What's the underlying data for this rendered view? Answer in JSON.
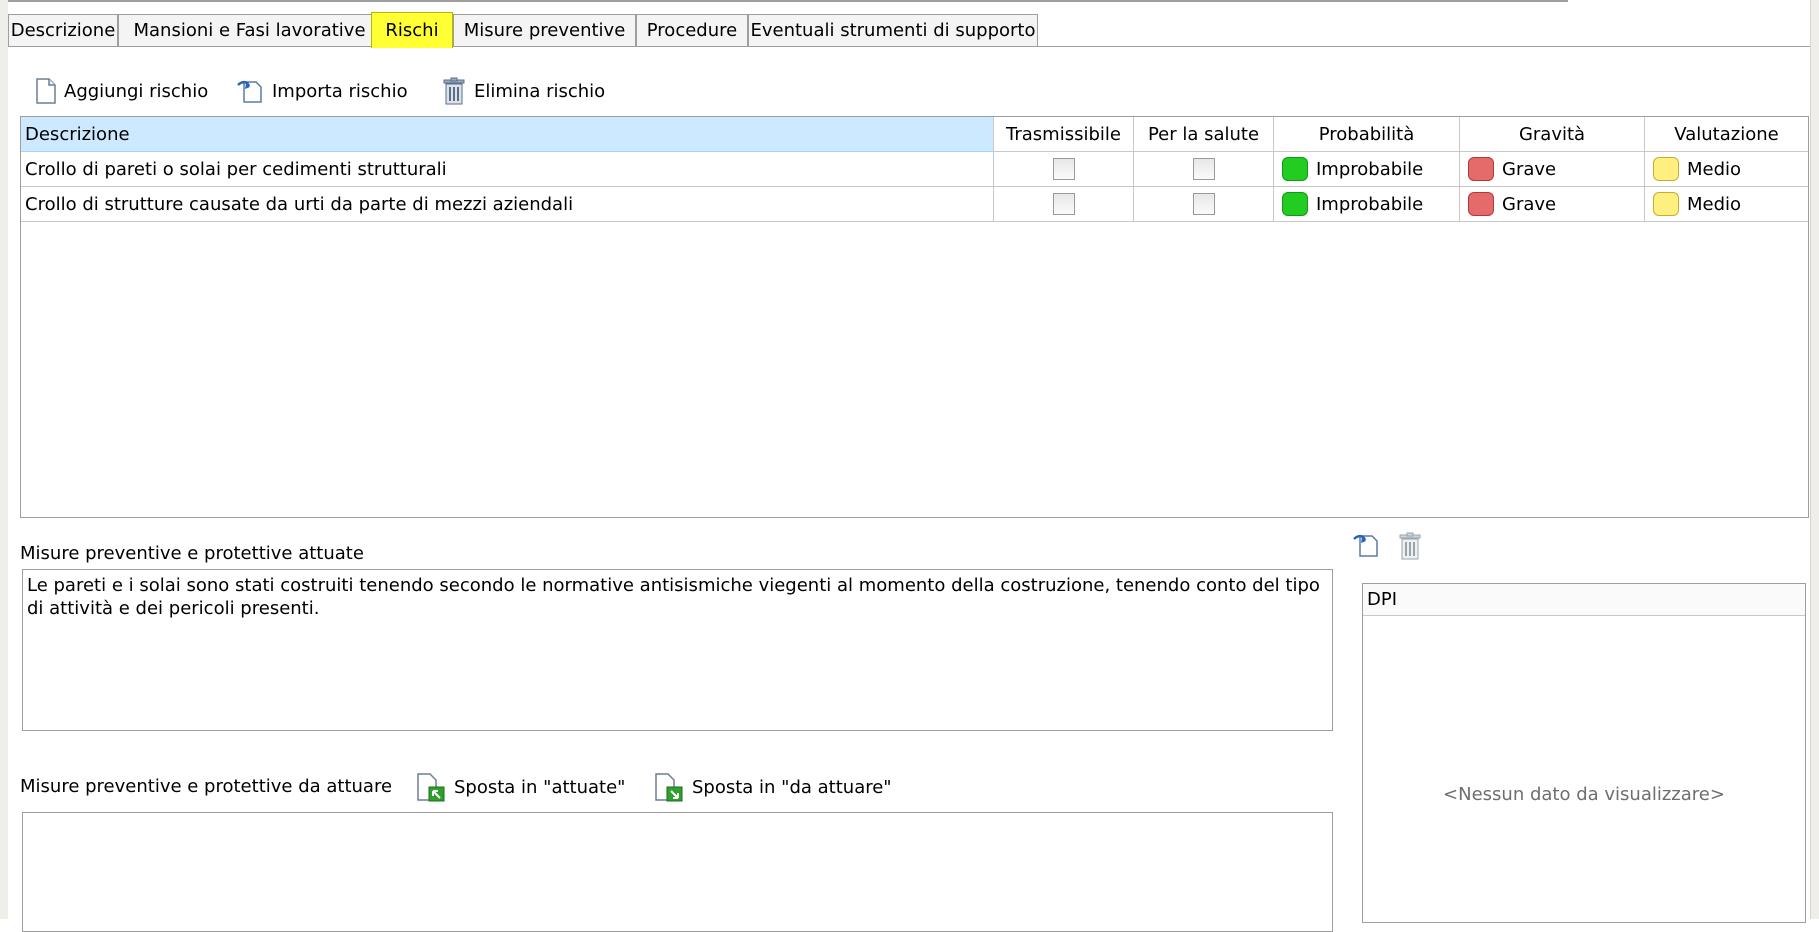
{
  "tabs": [
    {
      "label": "Descrizione",
      "active": false
    },
    {
      "label": "Mansioni e Fasi lavorative",
      "active": false
    },
    {
      "label": "Rischi",
      "active": true
    },
    {
      "label": "Misure preventive",
      "active": false
    },
    {
      "label": "Procedure",
      "active": false
    },
    {
      "label": "Eventuali strumenti di supporto",
      "active": false
    }
  ],
  "toolbar": {
    "add_label": "Aggiungi rischio",
    "import_label": "Importa rischio",
    "delete_label": "Elimina rischio"
  },
  "grid": {
    "columns": [
      "Descrizione",
      "Trasmissibile",
      "Per la salute",
      "Probabilità",
      "Gravità",
      "Valutazione"
    ],
    "rows": [
      {
        "descrizione": "Crollo di pareti o solai per cedimenti strutturali",
        "trasmissibile": false,
        "per_la_salute": false,
        "probabilita": "Improbabile",
        "gravita": "Grave",
        "valutazione": "Medio"
      },
      {
        "descrizione": "Crollo di strutture causate da urti da parte di mezzi aziendali",
        "trasmissibile": false,
        "per_la_salute": false,
        "probabilita": "Improbabile",
        "gravita": "Grave",
        "valutazione": "Medio"
      }
    ]
  },
  "colors": {
    "probability_green": "#22cc22",
    "severity_red": "#e56a6a",
    "evaluation_yellow": "#ffef80",
    "active_tab": "#ffff33",
    "header_highlight": "#cde9ff"
  },
  "attuate": {
    "label": "Misure preventive e protettive attuate",
    "text": "Le pareti e i solai sono stati costruiti tenendo secondo le normative antisismiche viegenti al momento della costruzione, tenendo conto del tipo di attività e dei pericoli presenti."
  },
  "da_attuare": {
    "label": "Misure preventive e protettive da attuare",
    "move_to_attuate": "Sposta in \"attuate\"",
    "move_to_da_attuare": "Sposta in \"da attuare\"",
    "text": ""
  },
  "dpi": {
    "header": "DPI",
    "empty_text": "<Nessun dato da visualizzare>"
  }
}
